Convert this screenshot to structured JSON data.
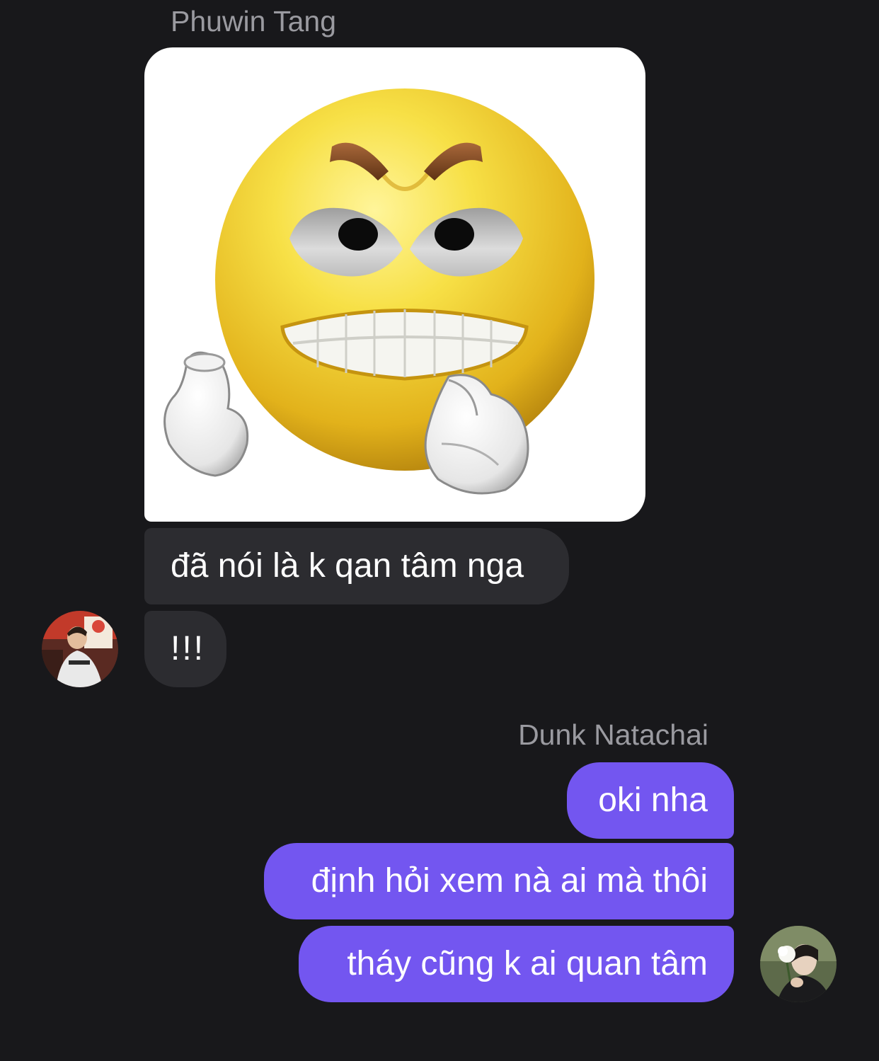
{
  "incoming": {
    "sender_name": "Phuwin Tang",
    "photo_icon": "angry-face-icon",
    "messages": [
      "đã nói là k qan tâm nga",
      "!!!"
    ]
  },
  "outgoing": {
    "sender_name": "Dunk Natachai",
    "messages": [
      "oki nha",
      "định hỏi xem nà ai mà thôi",
      "tháy cũng k ai quan tâm"
    ]
  },
  "colors": {
    "background": "#18181b",
    "incoming_bubble": "#2c2c30",
    "outgoing_bubble": "#7356f0",
    "sender_name": "#9a9aa0"
  }
}
